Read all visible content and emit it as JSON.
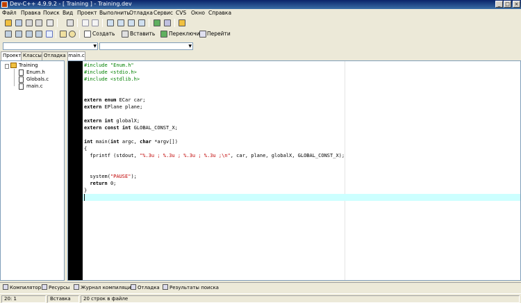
{
  "window": {
    "title": "Dev-C++ 4.9.9.2 - [ Training ] - Training.dev",
    "minimize": "_",
    "maximize": "□",
    "close": "×"
  },
  "menu": [
    "Файл",
    "Правка",
    "Поиск",
    "Вид",
    "Проект",
    "Выполнить",
    "Отладка",
    "Сервис",
    "CVS",
    "Окно",
    "Справка"
  ],
  "toolbar": {
    "create": "Создать",
    "insert": "Вставить",
    "toggle": "Переключить",
    "goto": "Перейти"
  },
  "left_panel": {
    "tabs": [
      "Проект",
      "Классы",
      "Отладка"
    ],
    "project": "Training",
    "files": [
      "Enum.h",
      "Globals.c",
      "main.c"
    ]
  },
  "editor": {
    "file_tab": "main.c",
    "lines": [
      "#include \"Enum.h\"",
      "#include <stdio.h>",
      "#include <stdlib.h>",
      "",
      "",
      "extern enum ECar car;",
      "extern EPlane plane;",
      "",
      "extern int globalX;",
      "extern const int GLOBAL_CONST_X;",
      "",
      "int main(int argc, char *argv[])",
      "{",
      "  fprintf (stdout, \"%.3u ; %.3u ; %.3u ; %.3u ;\\n\", car, plane, globalX, GLOBAL_CONST_X);",
      "",
      "",
      "  system(\"PAUSE\");",
      "  return 0;",
      "}",
      ""
    ]
  },
  "bottom_tabs": [
    "Компилятор",
    "Ресурсы",
    "Журнал компиляции",
    "Отладка",
    "Результаты поиска"
  ],
  "status": {
    "position": "20: 1",
    "mode": "Вставка",
    "lines_info": "20 строк в файле"
  }
}
